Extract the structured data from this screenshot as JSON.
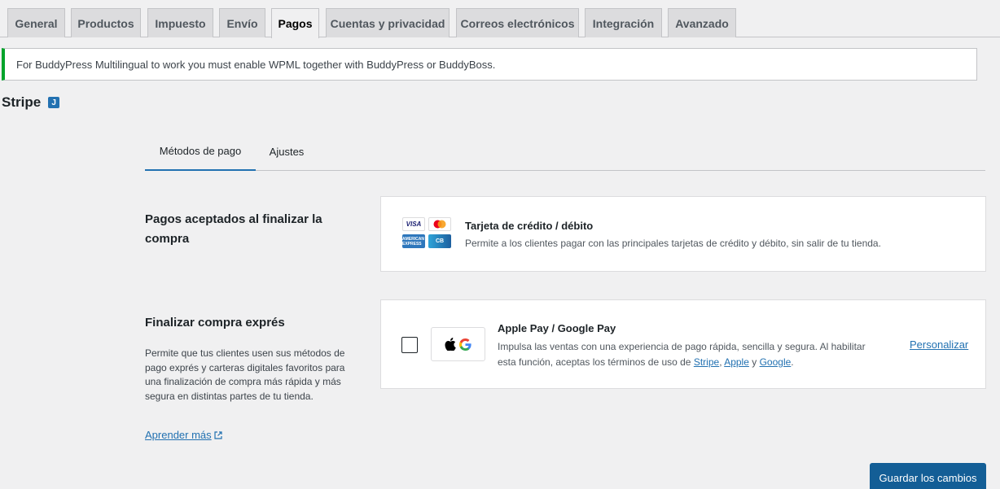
{
  "settings_tabs": [
    {
      "label": "General",
      "active": false
    },
    {
      "label": "Productos",
      "active": false
    },
    {
      "label": "Impuesto",
      "active": false
    },
    {
      "label": "Envío",
      "active": false
    },
    {
      "label": "Pagos",
      "active": true
    },
    {
      "label": "Cuentas y privacidad",
      "active": false
    },
    {
      "label": "Correos electrónicos",
      "active": false
    },
    {
      "label": "Integración",
      "active": false
    },
    {
      "label": "Avanzado",
      "active": false
    }
  ],
  "notice": {
    "text": "For BuddyPress Multilingual to work you must enable WPML together with BuddyPress or BuddyBoss.",
    "color": "#00a32a"
  },
  "page": {
    "title": "Stripe",
    "badge_glyph": "J"
  },
  "subtabs": [
    {
      "label": "Métodos de pago",
      "active": true
    },
    {
      "label": "Ajustes",
      "active": false
    }
  ],
  "accepted_section": {
    "title": "Pagos aceptados al finalizar la compra",
    "card": {
      "title": "Tarjeta de crédito / débito",
      "description": "Permite a los clientes pagar con las principales tarjetas de crédito y débito, sin salir de tu tienda.",
      "logos": [
        "VISA",
        "mastercard-logo",
        "AMERICAN EXPRESS",
        "CB"
      ]
    }
  },
  "express_section": {
    "title": "Finalizar compra exprés",
    "description": "Permite que tus clientes usen sus métodos de pago exprés y carteras digitales favoritos para una finalización de compra más rápida y más segura en distintas partes de tu tienda.",
    "learn_more": "Aprender más",
    "card": {
      "checked": false,
      "title": "Apple Pay / Google Pay",
      "desc_line1": "Impulsa las ventas con una experiencia de pago rápida, sencilla y segura. Al habilitar",
      "desc_line2_prefix": "esta función, aceptas los términos de uso de",
      "link_stripe": "Stripe",
      "sep_comma": ",",
      "link_apple": "Apple",
      "sep_y": "y",
      "link_google": "Google",
      "sep_end": ".",
      "customize": "Personalizar"
    }
  },
  "footer": {
    "save_label": "Guardar los cambios"
  },
  "colors": {
    "accent": "#2271b1",
    "button": "#135e96",
    "success": "#00a32a"
  }
}
